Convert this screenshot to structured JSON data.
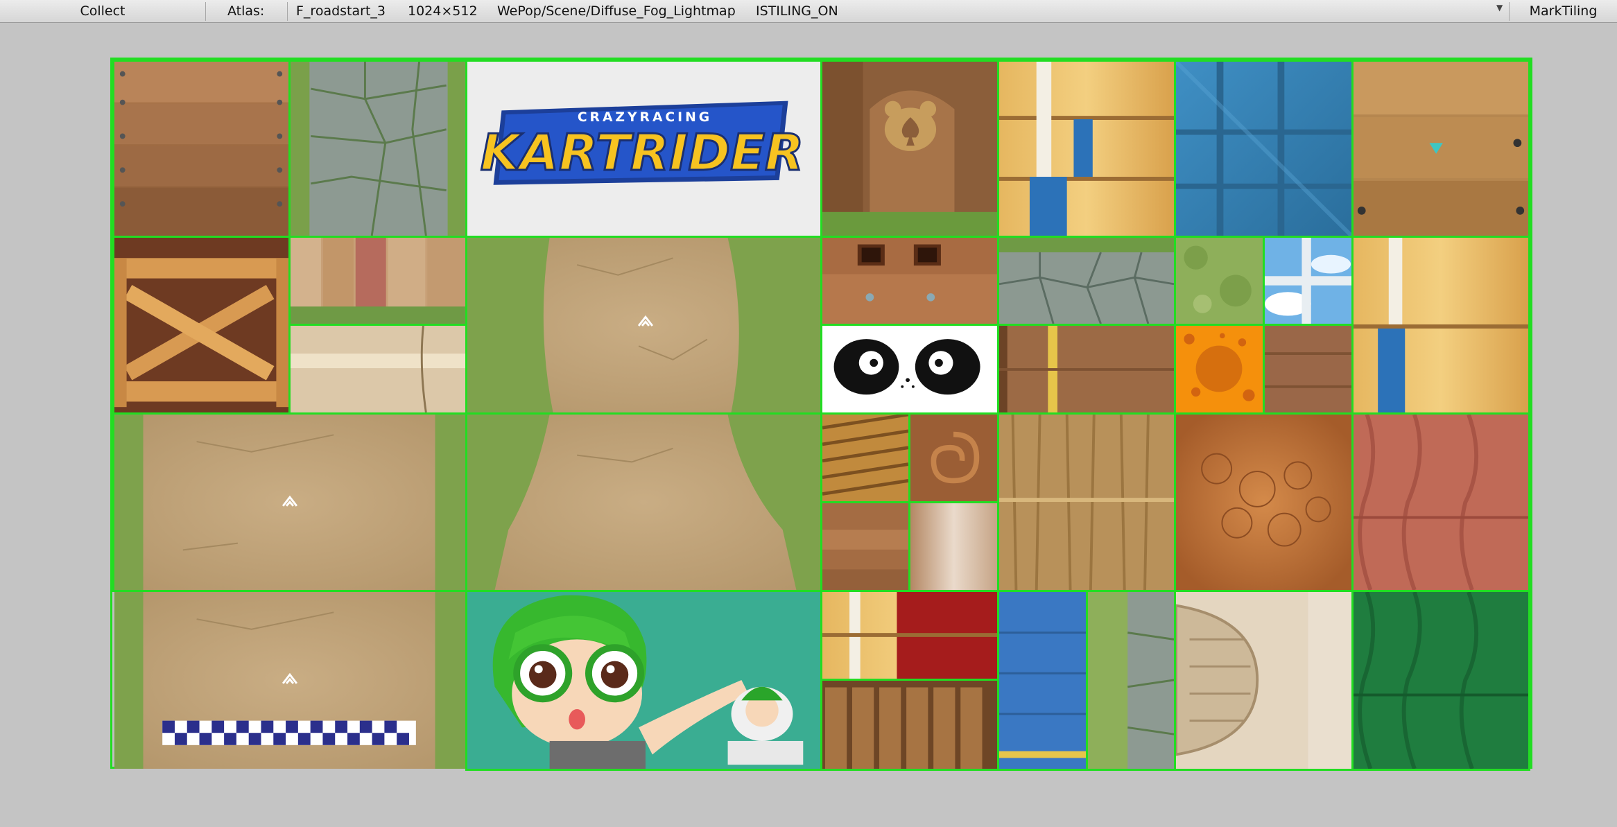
{
  "toolbar": {
    "collect_label": "Collect",
    "atlas_label": "Atlas:",
    "atlas_name": "F_roadstart_3",
    "atlas_size": "1024×512",
    "shader_name": "WePop/Scene/Diffuse_Fog_Lightmap",
    "tiling_status": "ISTILING_ON",
    "mark_tiling_label": "MarkTiling"
  },
  "atlas": {
    "logo": {
      "top_text": "CRAZYRACING",
      "main_text": "KARTRIDER"
    }
  },
  "colors": {
    "tile_border": "#22dd22",
    "background": "#c4c4c4",
    "toolbar": "#e2e2e2"
  }
}
